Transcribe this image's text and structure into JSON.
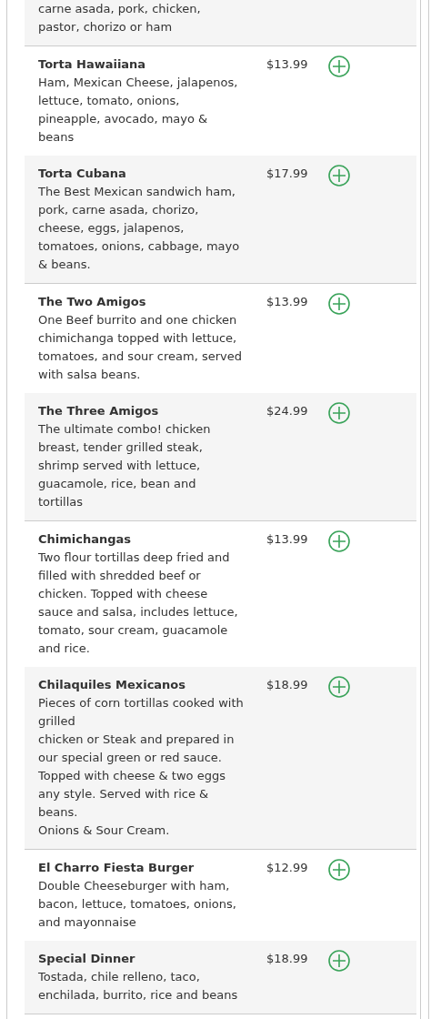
{
  "menu_items": [
    {
      "description": "carne asada, pork, chicken,\npastor, chorizo or ham"
    },
    {
      "name": "Torta Hawaiiana",
      "description": "Ham, Mexican Cheese, jalapenos, lettuce, tomato, onions, pineapple, avocado, mayo & beans",
      "price": "$13.99"
    },
    {
      "name": "Torta Cubana",
      "description": "The Best Mexican sandwich ham, pork, carne asada, chorizo, cheese, eggs, jalapenos, tomatoes, onions, cabbage, mayo & beans.",
      "price": "$17.99"
    },
    {
      "name": "The Two Amigos",
      "description": "One Beef burrito and one chicken chimichanga topped with lettuce, tomatoes, and sour cream, served with salsa beans.",
      "price": "$13.99"
    },
    {
      "name": "The Three Amigos",
      "description": "The ultimate combo! chicken breast, tender grilled steak, shrimp served with lettuce, guacamole, rice, bean and tortillas",
      "price": "$24.99"
    },
    {
      "name": "Chimichangas",
      "description": "Two flour tortillas deep fried and filled with shredded beef or chicken. Topped with cheese sauce and salsa, includes lettuce, tomato, sour cream, guacamole and rice.",
      "price": "$13.99"
    },
    {
      "name": "Chilaquiles Mexicanos",
      "description": "Pieces of corn tortillas cooked with grilled\nchicken or Steak and prepared in our special green or red sauce. Topped with cheese & two eggs any style. Served with rice & beans.\nOnions & Sour Cream.",
      "price": "$18.99"
    },
    {
      "name": "El Charro Fiesta Burger",
      "description": "Double Cheeseburger with ham, bacon, lettuce, tomatoes, onions, and mayonnaise",
      "price": "$12.99"
    },
    {
      "name": "Special Dinner",
      "description": "Tostada, chile relleno, taco, enchilada, burrito, rice and beans",
      "price": "$18.99"
    }
  ]
}
